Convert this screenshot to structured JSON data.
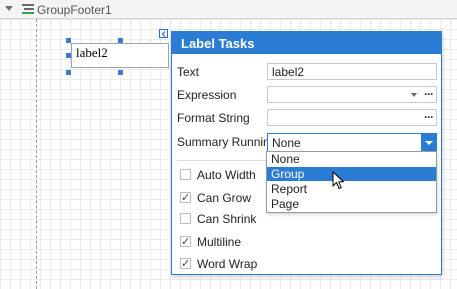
{
  "band": {
    "title": "GroupFooter1",
    "icon": "group-footer-band-icon"
  },
  "control": {
    "text": "label2"
  },
  "popup": {
    "title": "Label Tasks",
    "rows": {
      "text": {
        "label": "Text",
        "value": "label2"
      },
      "expression": {
        "label": "Expression",
        "value": ""
      },
      "format_string": {
        "label": "Format String",
        "value": ""
      },
      "summary_running": {
        "label": "Summary Running",
        "value": "None"
      }
    },
    "checkboxes": [
      {
        "label": "Auto Width",
        "checked": false
      },
      {
        "label": "Can Grow",
        "checked": true
      },
      {
        "label": "Can Shrink",
        "checked": false
      },
      {
        "label": "Multiline",
        "checked": true
      },
      {
        "label": "Word Wrap",
        "checked": true
      }
    ],
    "ellipsis": "···"
  },
  "dropdown": {
    "options": [
      "None",
      "Group",
      "Report",
      "Page"
    ],
    "highlighted": "Group"
  },
  "colors": {
    "accent": "#2b7cd3",
    "header_text": "#ffffff"
  }
}
